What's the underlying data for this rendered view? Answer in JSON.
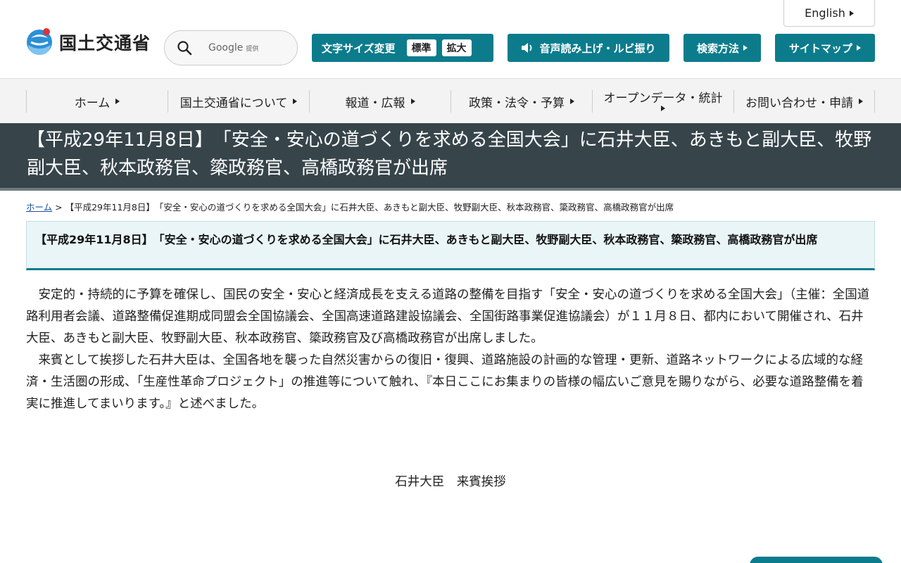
{
  "header": {
    "logo_text": "国土交通省",
    "search_label": "Google",
    "search_provider": "提供",
    "english_label": "English",
    "fontsize_label": "文字サイズ変更",
    "fontsize_standard": "標準",
    "fontsize_large": "拡大",
    "voice_label": "音声読み上げ・ルビ振り",
    "search_method_label": "検索方法",
    "sitemap_label": "サイトマップ"
  },
  "nav": {
    "items": [
      {
        "label": "ホーム"
      },
      {
        "label": "国土交通省について"
      },
      {
        "label": "報道・広報"
      },
      {
        "label": "政策・法令・予算"
      },
      {
        "label": "オープンデータ・統計"
      },
      {
        "label": "お問い合わせ・申請"
      }
    ]
  },
  "page": {
    "title": "【平成29年11月8日】　「安全・安心の道づくりを求める全国大会」に石井大臣、あきもと副大臣、牧野副大臣、秋本政務官、簗政務官、高橋政務官が出席",
    "breadcrumb_home": "ホーム",
    "breadcrumb_sep": ">",
    "breadcrumb_current": "【平成29年11月8日】　「安全・安心の道づくりを求める全国大会」に石井大臣、あきもと副大臣、牧野副大臣、秋本政務官、簗政務官、高橋政務官が出席",
    "subheading": "【平成29年11月8日】　「安全・安心の道づくりを求める全国大会」に石井大臣、あきもと副大臣、牧野副大臣、秋本政務官、簗政務官、高橋政務官が出席",
    "paragraph1": "安定的・持続的に予算を確保し、国民の安全・安心と経済成長を支える道路の整備を目指す「安全・安心の道づくりを求める全国大会」（主催：全国道路利用者会議、道路整備促進期成同盟会全国協議会、全国高速道路建設協議会、全国街路事業促進協議会）が１１月８日、都内において開催され、石井大臣、あきもと副大臣、牧野副大臣、秋本政務官、簗政務官及び高橋政務官が出席しました。",
    "paragraph2": "来賓として挨拶した石井大臣は、全国各地を襲った自然災害からの復旧・復興、道路施設の計画的な管理・更新、道路ネットワークによる広域的な経済・生活圏の形成、「生産性革命プロジェクト」の推進等について触れ、『本日ここにお集まりの皆様の幅広いご意見を賜りながら、必要な道路整備を着実に推進してまいります。』と述べました。",
    "caption": "石井大臣　来賓挨拶"
  },
  "colors": {
    "accent": "#0c7c8c",
    "title_bar": "#37454b",
    "nav_bg": "#f3f3f3"
  }
}
